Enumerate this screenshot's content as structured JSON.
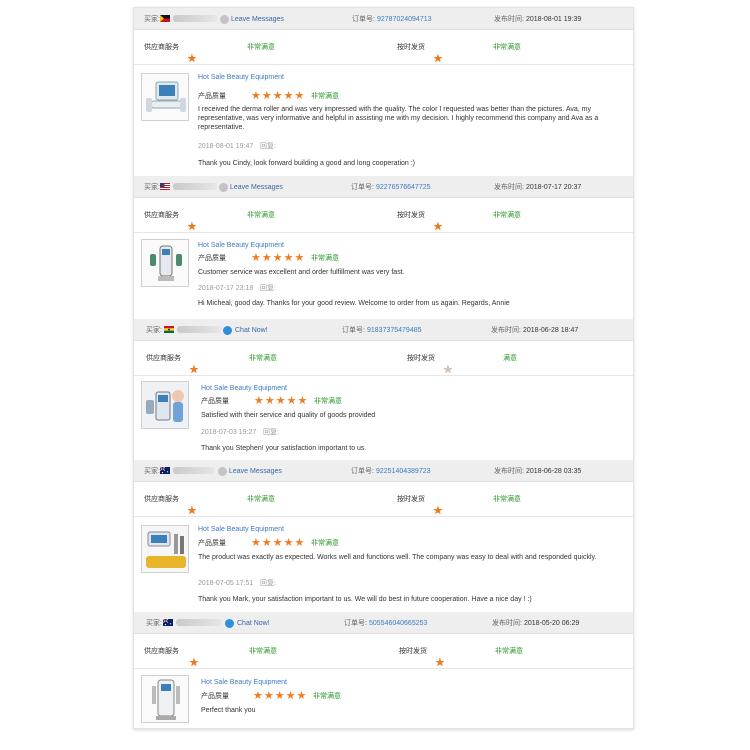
{
  "labels": {
    "buyer": "买家:",
    "order": "订单号:",
    "published": "发布时间:",
    "supplier_service": "供应商服务",
    "on_time_delivery": "按时发货",
    "product_quality": "产品质量",
    "reply": "回复:"
  },
  "colors": {
    "star": "#f07c21",
    "link": "#3c7bc3",
    "good": "#2d9a2d",
    "header_bg": "#eeeeee"
  },
  "reviews": [
    {
      "contact": "Leave Messages",
      "contact_icon": "grey-circle-icon",
      "flag": "red-yellow-flag",
      "order_no": "92787024094713",
      "published": "2018-08-01 19:39",
      "supplier_stars": 5,
      "supplier_text": "非常满意",
      "delivery_stars": 5,
      "delivery_text": "非常满意",
      "product_title": "Hot Sale Beauty Equipment",
      "quality_stars": 5,
      "quality_text": "非常满意",
      "review": "I received the derma roller and was very impressed with the quality. The color I requested was better than the pictures. Ava, my representative, was very informative and helpful in assisting me with my decision. I highly recommend this company and Ava as a representative.",
      "reply_time": "2018-08-01 19:47",
      "reply": "Thank you Cindy, look forward building a good and long cooperation :)"
    },
    {
      "contact": "Leave Messages",
      "contact_icon": "grey-circle-icon",
      "flag": "us-flag",
      "order_no": "92276576647725",
      "published": "2018-07-17 20:37",
      "supplier_stars": 5,
      "supplier_text": "非常满意",
      "delivery_stars": 5,
      "delivery_text": "非常满意",
      "product_title": "Hot Sale Beauty Equipment",
      "quality_stars": 5,
      "quality_text": "非常满意",
      "review": "Customer service was excellent and order fulfillment was very fast.",
      "reply_time": "2018-07-17 23:18",
      "reply": "Hi Micheal, good day. Thanks for your good review. Welcome to order from us again. Regards, Annie"
    },
    {
      "contact": "Chat Now!",
      "contact_icon": "blue-chat-icon",
      "flag": "ghana-flag",
      "order_no": "91837375479485",
      "published": "2018-06-28 18:47",
      "supplier_stars": 5,
      "supplier_text": "非常满意",
      "delivery_stars": 4,
      "delivery_text": "满意",
      "product_title": "Hot Sale Beauty Equipment",
      "quality_stars": 5,
      "quality_text": "非常满意",
      "review": "Satisfied with their service and quality of goods provided",
      "reply_time": "2018-07-03 19:27",
      "reply": "Thank you Stephen! your satisfaction important to us."
    },
    {
      "contact": "Leave Messages",
      "contact_icon": "grey-circle-icon",
      "flag": "au-flag",
      "order_no": "92251404389723",
      "published": "2018-06-28 03:35",
      "supplier_stars": 5,
      "supplier_text": "非常满意",
      "delivery_stars": 5,
      "delivery_text": "非常满意",
      "product_title": "Hot Sale Beauty Equipment",
      "quality_stars": 5,
      "quality_text": "非常满意",
      "review": "The product was exactly as expected. Works well and functions well. The company was easy to deal with and responded quickly.",
      "reply_time": "2018-07-05 17:51",
      "reply": "Thank you Mark, your satisfaction important to us. We will do best in future cooperation. Have a nice day ! :)"
    },
    {
      "contact": "Chat Now!",
      "contact_icon": "blue-chat-icon",
      "flag": "au-flag",
      "order_no": "505546040665253",
      "published": "2018-05-20 06:29",
      "supplier_stars": 5,
      "supplier_text": "非常满意",
      "delivery_stars": 5,
      "delivery_text": "非常满意",
      "product_title": "Hot Sale Beauty Equipment",
      "quality_stars": 5,
      "quality_text": "非常满意",
      "review": "Perfect thank you",
      "reply_time": "",
      "reply": ""
    }
  ]
}
